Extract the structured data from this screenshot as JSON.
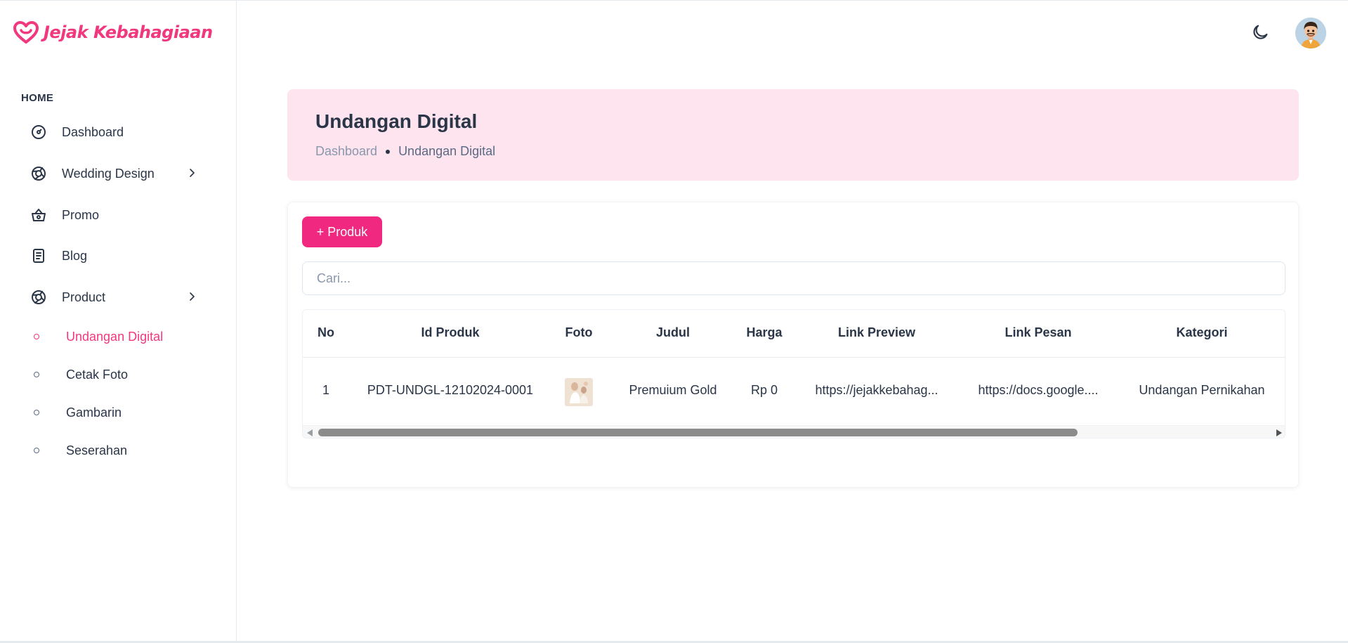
{
  "brand": {
    "name": "Jejak Kebahagiaan",
    "color": "#f1387f"
  },
  "sidebar": {
    "caption": "HOME",
    "items": [
      {
        "label": "Dashboard",
        "icon": "gauge-icon"
      },
      {
        "label": "Wedding Design",
        "icon": "aperture-icon",
        "expandable": true
      },
      {
        "label": "Promo",
        "icon": "basket-icon"
      },
      {
        "label": "Blog",
        "icon": "document-icon"
      },
      {
        "label": "Product",
        "icon": "aperture-icon",
        "expandable": true
      }
    ],
    "sub_items": [
      {
        "label": "Undangan Digital",
        "active": true
      },
      {
        "label": "Cetak Foto",
        "active": false
      },
      {
        "label": "Gambarin",
        "active": false
      },
      {
        "label": "Seserahan",
        "active": false
      }
    ]
  },
  "header": {
    "theme_icon": "moon-icon",
    "avatar": "user-avatar"
  },
  "banner": {
    "title": "Undangan Digital",
    "breadcrumb": [
      "Dashboard",
      "Undangan Digital"
    ]
  },
  "toolbar": {
    "add_label": "+ Produk",
    "search_placeholder": "Cari..."
  },
  "table": {
    "columns": [
      "No",
      "Id Produk",
      "Foto",
      "Judul",
      "Harga",
      "Link Preview",
      "Link Pesan",
      "Kategori"
    ],
    "rows": [
      {
        "no": "1",
        "id": "PDT-UNDGL-12102024-0001",
        "foto": "product-thumbnail",
        "judul": "Premuium Gold",
        "harga": "Rp 0",
        "link_preview": "https://jejakkebahag...",
        "link_pesan": "https://docs.google....",
        "kategori": "Undangan Pernikahan"
      }
    ]
  },
  "colors": {
    "accent": "#f1287f",
    "banner_bg": "#fde4ef",
    "text": "#2a3547"
  }
}
